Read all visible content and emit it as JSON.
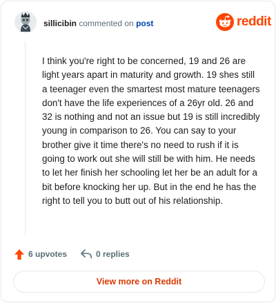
{
  "header": {
    "username": "sillicibin",
    "verb": "commented on",
    "post_link": "post",
    "brand": "reddit"
  },
  "comment": {
    "body": "I think you're right to be concerned, 19 and 26 are light years apart in maturity and growth. 19 shes still a teenager even the smartest most mature teenagers don't have the life experiences of a 26yr old. 26 and 32 is nothing and not an issue but 19 is still incredibly young in comparison to 26. You can say to your brother give it time there's no need to rush if it is going to work out she will still be with him. He needs to let her finish her schooling let her be an adult for a bit before knocking her up. But in the end he has the right to tell you to butt out of his relationship."
  },
  "actions": {
    "upvotes": "6 upvotes",
    "replies": "0 replies"
  },
  "footer": {
    "more_label": "View more on Reddit"
  },
  "colors": {
    "accent": "#ff4500",
    "link": "#0045ac",
    "muted": "#576f76",
    "button_text": "#d93a00"
  },
  "icons": {
    "avatar": "user-avatar",
    "brand": "reddit-logo-icon",
    "upvote": "upvote-arrow-icon",
    "reply": "reply-arrow-icon"
  }
}
